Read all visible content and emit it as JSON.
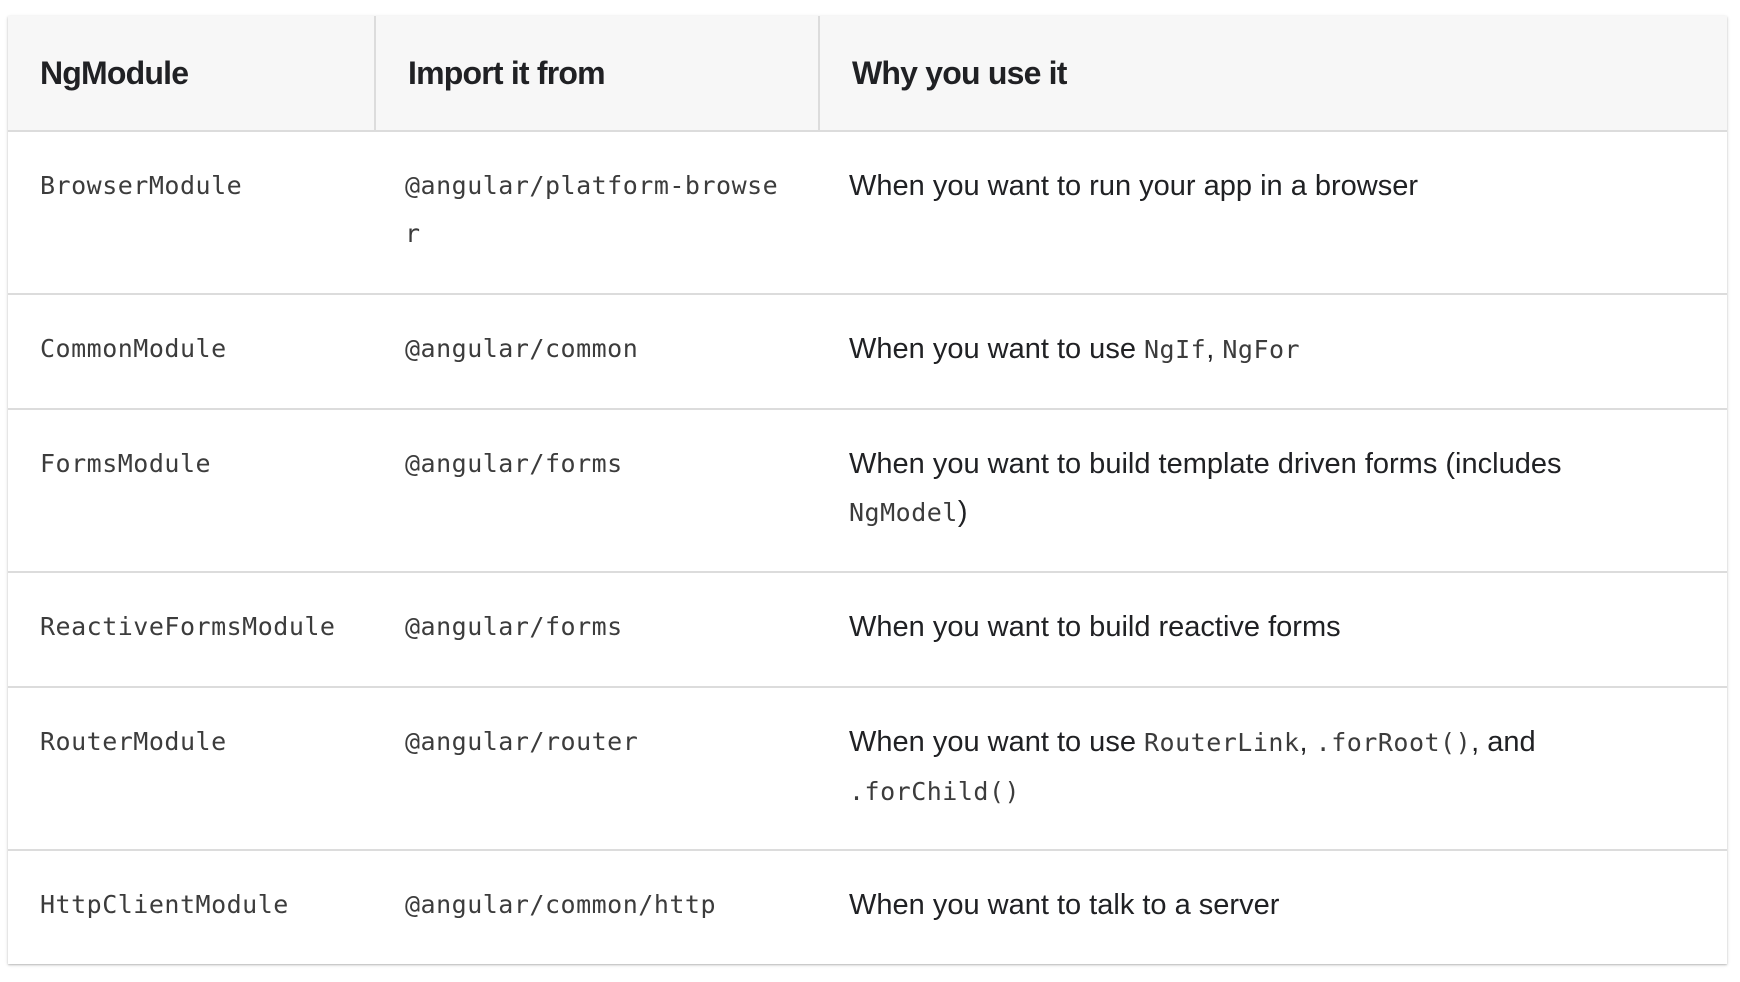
{
  "table": {
    "headers": [
      "NgModule",
      "Import it from",
      "Why you use it"
    ],
    "rows": [
      {
        "module": "BrowserModule",
        "import_from": "@angular/platform-browser",
        "why": [
          "When you want to run your app in a browser"
        ]
      },
      {
        "module": "CommonModule",
        "import_from": "@angular/common",
        "why": [
          "When you want to use ",
          "NgIf",
          ", ",
          "NgFor"
        ]
      },
      {
        "module": "FormsModule",
        "import_from": "@angular/forms",
        "why": [
          "When you want to build template driven forms (includes ",
          "NgModel",
          ")"
        ]
      },
      {
        "module": "ReactiveFormsModule",
        "import_from": "@angular/forms",
        "why": [
          "When you want to build reactive forms"
        ]
      },
      {
        "module": "RouterModule",
        "import_from": "@angular/router",
        "why": [
          "When you want to use ",
          "RouterLink",
          ", ",
          ".forRoot()",
          ", and ",
          ".forChild()"
        ]
      },
      {
        "module": "HttpClientModule",
        "import_from": "@angular/common/http",
        "why": [
          "When you want to talk to a server"
        ]
      }
    ]
  }
}
